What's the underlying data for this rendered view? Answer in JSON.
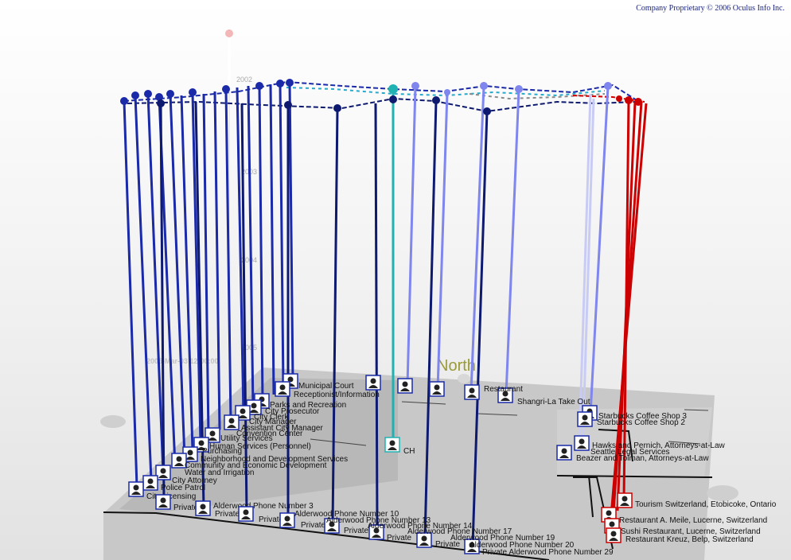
{
  "copyright": "Company Proprietary © 2006 Oculus Info Inc.",
  "compass_label": "North",
  "date_marker": "2005-Mar-03 12:00:00",
  "year_ticks": [
    "2002",
    "2003",
    "2004",
    "2005"
  ],
  "colors": {
    "city": "#1a2aa8",
    "private": "#0d1a70",
    "business": "#7f86ee",
    "switzerland": "#cc0000",
    "center": "#20b2b2"
  },
  "labels": {
    "municipal_court": "Municipal Court",
    "receptionist": "Receptionist/Information",
    "parks": "Parks and Recreation",
    "prosecutor": "City Prosecutor",
    "city_clerk": "City Clerk",
    "city_manager": "City Manager",
    "asst_manager": "Assistant City Manager",
    "convention": "Convention Center",
    "utility": "Utility Services",
    "human_services": "Human Services (Personnel)",
    "purchasing": "Purchasing",
    "neighborhood": "Neighborhood and Development Services",
    "community": "Community and Economic Development",
    "water": "Water and Irrigation",
    "attorney": "City Attorney",
    "police": "Police Patrol",
    "licensing": "City Licensing",
    "private": "Private",
    "phone3": "Alderwood Phone Number 3",
    "phone10": "Alderwood Phone Number 10",
    "phone13": "Alderwood Phone Number 13",
    "phone14": "Alderwood Phone Number 14",
    "phone17": "Alderwood Phone Number 17",
    "phone19": "Alderwood Phone Number 19",
    "phone20": "Alderwood Phone Number 20",
    "phone29": "Private Alderwood Phone Number 29",
    "ch": "CH",
    "restaurant": "Restaurant",
    "shangrila": "Shangri-La Take Out",
    "starbucks3": "Starbucks Coffee Shop 3",
    "starbucks2": "Starbucks Coffee Shop 2",
    "hawks": "Hawks and Pernich, Attorneys-at-Law",
    "seattle_legal": "Seattle Legal Services",
    "beazer": "Beazer and Tolman, Attorneys-at-Law",
    "tourism": "Tourism Switzerland, Etobicoke, Ontario",
    "meile": "Restaurant A. Meile, Lucerne, Switzerland",
    "sushi": "Sushi Restaurant, Lucerne, Switzerland",
    "kreuz": "Restaurant Kreuz, Belp, Switzerland"
  }
}
